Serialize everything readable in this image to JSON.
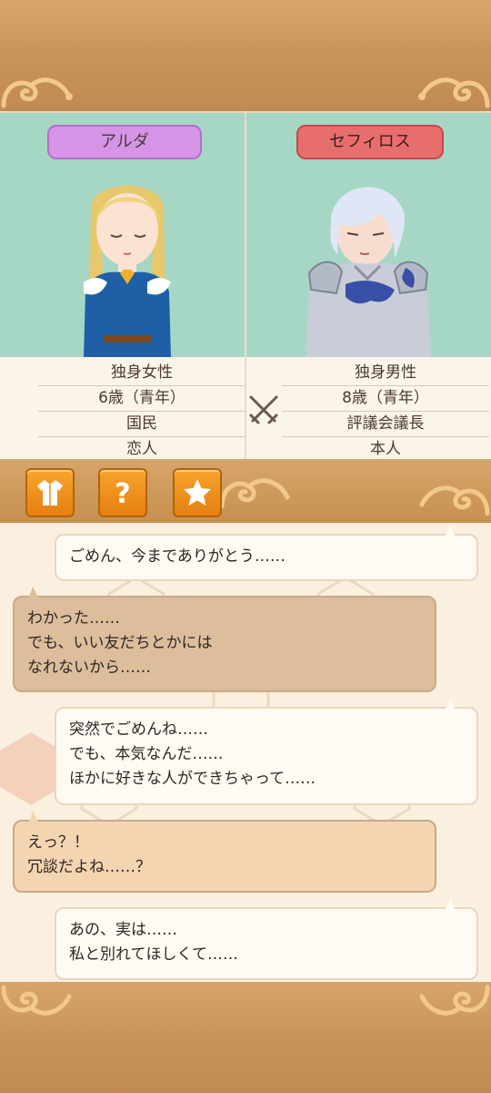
{
  "characters": {
    "left": {
      "name": "アルダ",
      "tag_color": "#d694e6",
      "info": [
        "独身女性",
        "6歳（青年）",
        "国民",
        "恋人"
      ]
    },
    "right": {
      "name": "セフィロス",
      "tag_color": "#e86e6e",
      "info": [
        "独身男性",
        "8歳（青年）",
        "評議会議長",
        "本人"
      ]
    },
    "versus_icon": "crossed-swords-icon"
  },
  "toolbar": {
    "buttons": [
      {
        "icon": "outfit-icon"
      },
      {
        "icon": "question-icon"
      },
      {
        "icon": "star-icon"
      }
    ]
  },
  "chat": {
    "messages": [
      {
        "side": "right",
        "lines": [
          "ごめん、今までありがとう……"
        ]
      },
      {
        "side": "left",
        "lines": [
          "わかった……",
          "でも、いい友だちとかには",
          "なれないから……"
        ]
      },
      {
        "side": "right",
        "lines": [
          "突然でごめんね……",
          "でも、本気なんだ……",
          "ほかに好きな人ができちゃって……"
        ]
      },
      {
        "side": "left",
        "lines": [
          "えっ？！",
          "冗談だよね……？"
        ]
      },
      {
        "side": "right",
        "lines": [
          "あの、実は……",
          "私と別れてほしくて……"
        ]
      }
    ]
  },
  "colors": {
    "wood": "#c99459",
    "panel_bg": "#a6d7c4",
    "button_orange": "#f29a24"
  }
}
